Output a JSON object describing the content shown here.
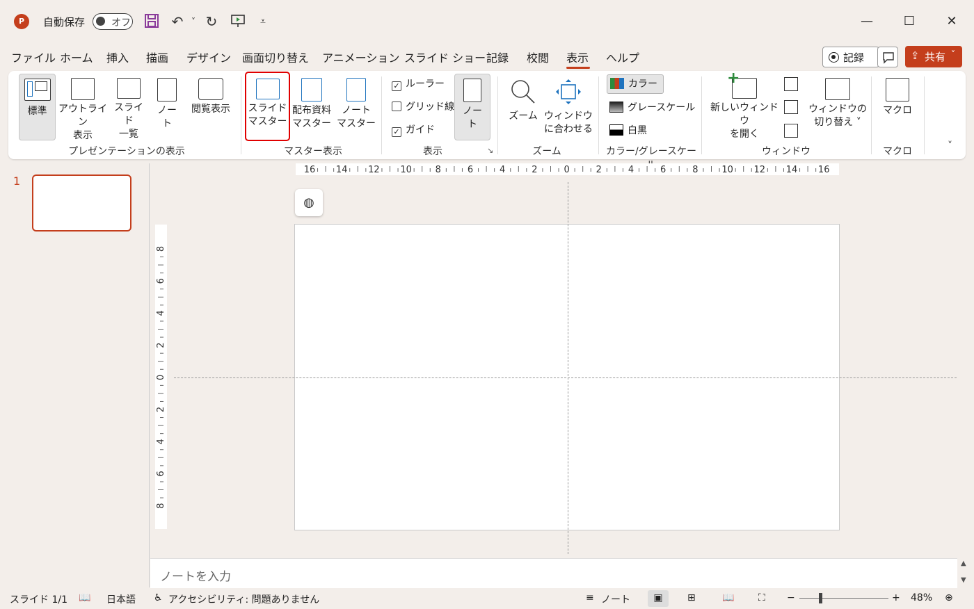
{
  "titlebar": {
    "app_icon": "powerpoint-logo",
    "autosave_label": "自動保存",
    "autosave_state": "オフ",
    "minimize": "—",
    "maximize": "☐",
    "close": "✕"
  },
  "tabs": [
    "ファイル",
    "ホーム",
    "挿入",
    "描画",
    "デザイン",
    "画面切り替え",
    "アニメーション",
    "スライド ショー",
    "記録",
    "校閲",
    "表示",
    "ヘルプ"
  ],
  "active_tab": "表示",
  "header_actions": {
    "record": "記録",
    "share": "共有"
  },
  "ribbon": {
    "groups": {
      "presentation_views": "プレゼンテーションの表示",
      "master_views": "マスター表示",
      "show": "表示",
      "zoom": "ズーム",
      "color": "カラー/グレースケール",
      "window": "ウィンドウ",
      "macros": "マクロ"
    },
    "buttons": {
      "normal": "標準",
      "outline_1": "アウトライン",
      "outline_2": "表示",
      "sorter_1": "スライド",
      "sorter_2": "一覧",
      "notes_page_1": "ノー",
      "notes_page_2": "ト",
      "reading": "閲覧表示",
      "slide_master_1": "スライド",
      "slide_master_2": "マスター",
      "handout_master_1": "配布資料",
      "handout_master_2": "マスター",
      "notes_master_1": "ノート",
      "notes_master_2": "マスター",
      "notes_1": "ノー",
      "notes_2": "ト",
      "zoom": "ズーム",
      "fit_1": "ウィンドウ",
      "fit_2": "に合わせる",
      "new_window_1": "新しいウィンドウ",
      "new_window_2": "を開く",
      "switch_1": "ウィンドウの",
      "switch_2": "切り替え ˅",
      "macros": "マクロ"
    },
    "checks": [
      {
        "label": "ルーラー",
        "checked": true
      },
      {
        "label": "グリッド線",
        "checked": false
      },
      {
        "label": "ガイド",
        "checked": true
      }
    ],
    "color_modes": [
      "カラー",
      "グレースケール",
      "白黒"
    ],
    "highlighted_button": "slide-master"
  },
  "slides": {
    "thumbnail_number": "1"
  },
  "rulers": {
    "horizontal": [
      "16",
      "14",
      "12",
      "10",
      "8",
      "6",
      "4",
      "2",
      "0",
      "2",
      "4",
      "6",
      "8",
      "10",
      "12",
      "14",
      "16"
    ],
    "vertical": [
      "8",
      "6",
      "4",
      "2",
      "0",
      "2",
      "4",
      "6",
      "8"
    ]
  },
  "notes_placeholder": "ノートを入力",
  "statusbar": {
    "slide": "スライド 1/1",
    "language": "日本語",
    "accessibility": "アクセシビリティ: 問題ありません",
    "notes": "ノート",
    "zoom": "48%"
  },
  "colors": {
    "accent": "#c43e1c",
    "highlight": "#e00000"
  }
}
